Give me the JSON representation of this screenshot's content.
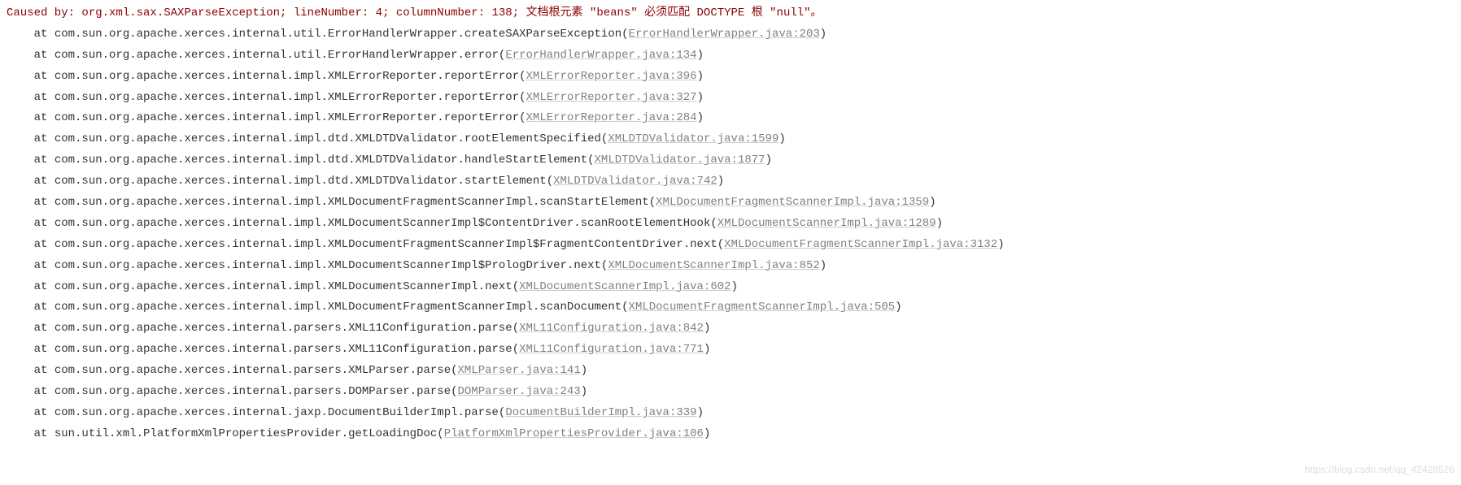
{
  "exception": {
    "prefix": "Caused by: ",
    "message": "org.xml.sax.SAXParseException; lineNumber: 4; columnNumber: 138; 文档根元素 \"beans\" 必须匹配 DOCTYPE 根 \"null\"。"
  },
  "frames": [
    {
      "at": "at ",
      "method": "com.sun.org.apache.xerces.internal.util.ErrorHandlerWrapper.createSAXParseException",
      "open": "(",
      "source": "ErrorHandlerWrapper.java:203",
      "close": ")"
    },
    {
      "at": "at ",
      "method": "com.sun.org.apache.xerces.internal.util.ErrorHandlerWrapper.error",
      "open": "(",
      "source": "ErrorHandlerWrapper.java:134",
      "close": ")"
    },
    {
      "at": "at ",
      "method": "com.sun.org.apache.xerces.internal.impl.XMLErrorReporter.reportError",
      "open": "(",
      "source": "XMLErrorReporter.java:396",
      "close": ")"
    },
    {
      "at": "at ",
      "method": "com.sun.org.apache.xerces.internal.impl.XMLErrorReporter.reportError",
      "open": "(",
      "source": "XMLErrorReporter.java:327",
      "close": ")"
    },
    {
      "at": "at ",
      "method": "com.sun.org.apache.xerces.internal.impl.XMLErrorReporter.reportError",
      "open": "(",
      "source": "XMLErrorReporter.java:284",
      "close": ")"
    },
    {
      "at": "at ",
      "method": "com.sun.org.apache.xerces.internal.impl.dtd.XMLDTDValidator.rootElementSpecified",
      "open": "(",
      "source": "XMLDTDValidator.java:1599",
      "close": ")"
    },
    {
      "at": "at ",
      "method": "com.sun.org.apache.xerces.internal.impl.dtd.XMLDTDValidator.handleStartElement",
      "open": "(",
      "source": "XMLDTDValidator.java:1877",
      "close": ")"
    },
    {
      "at": "at ",
      "method": "com.sun.org.apache.xerces.internal.impl.dtd.XMLDTDValidator.startElement",
      "open": "(",
      "source": "XMLDTDValidator.java:742",
      "close": ")"
    },
    {
      "at": "at ",
      "method": "com.sun.org.apache.xerces.internal.impl.XMLDocumentFragmentScannerImpl.scanStartElement",
      "open": "(",
      "source": "XMLDocumentFragmentScannerImpl.java:1359",
      "close": ")"
    },
    {
      "at": "at ",
      "method": "com.sun.org.apache.xerces.internal.impl.XMLDocumentScannerImpl$ContentDriver.scanRootElementHook",
      "open": "(",
      "source": "XMLDocumentScannerImpl.java:1289",
      "close": ")"
    },
    {
      "at": "at ",
      "method": "com.sun.org.apache.xerces.internal.impl.XMLDocumentFragmentScannerImpl$FragmentContentDriver.next",
      "open": "(",
      "source": "XMLDocumentFragmentScannerImpl.java:3132",
      "close": ")"
    },
    {
      "at": "at ",
      "method": "com.sun.org.apache.xerces.internal.impl.XMLDocumentScannerImpl$PrologDriver.next",
      "open": "(",
      "source": "XMLDocumentScannerImpl.java:852",
      "close": ")"
    },
    {
      "at": "at ",
      "method": "com.sun.org.apache.xerces.internal.impl.XMLDocumentScannerImpl.next",
      "open": "(",
      "source": "XMLDocumentScannerImpl.java:602",
      "close": ")"
    },
    {
      "at": "at ",
      "method": "com.sun.org.apache.xerces.internal.impl.XMLDocumentFragmentScannerImpl.scanDocument",
      "open": "(",
      "source": "XMLDocumentFragmentScannerImpl.java:505",
      "close": ")"
    },
    {
      "at": "at ",
      "method": "com.sun.org.apache.xerces.internal.parsers.XML11Configuration.parse",
      "open": "(",
      "source": "XML11Configuration.java:842",
      "close": ")"
    },
    {
      "at": "at ",
      "method": "com.sun.org.apache.xerces.internal.parsers.XML11Configuration.parse",
      "open": "(",
      "source": "XML11Configuration.java:771",
      "close": ")"
    },
    {
      "at": "at ",
      "method": "com.sun.org.apache.xerces.internal.parsers.XMLParser.parse",
      "open": "(",
      "source": "XMLParser.java:141",
      "close": ")"
    },
    {
      "at": "at ",
      "method": "com.sun.org.apache.xerces.internal.parsers.DOMParser.parse",
      "open": "(",
      "source": "DOMParser.java:243",
      "close": ")"
    },
    {
      "at": "at ",
      "method": "com.sun.org.apache.xerces.internal.jaxp.DocumentBuilderImpl.parse",
      "open": "(",
      "source": "DocumentBuilderImpl.java:339",
      "close": ")"
    },
    {
      "at": "at ",
      "method": "sun.util.xml.PlatformXmlPropertiesProvider.getLoadingDoc",
      "open": "(",
      "source": "PlatformXmlPropertiesProvider.java:106",
      "close": ")"
    }
  ],
  "watermark": "https://blog.csdn.net/qq_42428528"
}
